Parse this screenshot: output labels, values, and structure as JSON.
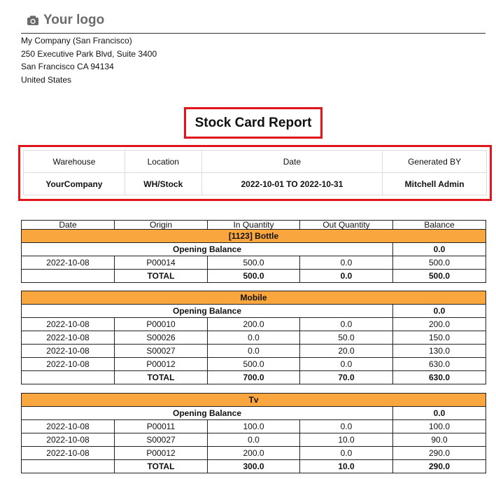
{
  "logo": {
    "text": "Your logo",
    "icon": "camera-icon"
  },
  "company": {
    "lines": [
      "My Company (San Francisco)",
      "250 Executive Park Blvd, Suite 3400",
      "San Francisco CA 94134",
      "United States"
    ]
  },
  "report": {
    "title": "Stock Card Report"
  },
  "info": {
    "headers": [
      "Warehouse",
      "Location",
      "Date",
      "Generated BY"
    ],
    "values": [
      "YourCompany",
      "WH/Stock",
      "2022-10-01 TO 2022-10-31",
      "Mitchell Admin"
    ]
  },
  "columns": [
    "Date",
    "Origin",
    "In Quantity",
    "Out Quantity",
    "Balance"
  ],
  "opening_label": "Opening Balance",
  "total_label": "TOTAL",
  "products": [
    {
      "name": "[1123] Bottle",
      "opening": "0.0",
      "rows": [
        {
          "date": "2022-10-08",
          "origin": "P00014",
          "in": "500.0",
          "out": "0.0",
          "balance": "500.0"
        }
      ],
      "total": {
        "in": "500.0",
        "out": "0.0",
        "balance": "500.0"
      }
    },
    {
      "name": "Mobile",
      "opening": "0.0",
      "rows": [
        {
          "date": "2022-10-08",
          "origin": "P00010",
          "in": "200.0",
          "out": "0.0",
          "balance": "200.0"
        },
        {
          "date": "2022-10-08",
          "origin": "S00026",
          "in": "0.0",
          "out": "50.0",
          "balance": "150.0"
        },
        {
          "date": "2022-10-08",
          "origin": "S00027",
          "in": "0.0",
          "out": "20.0",
          "balance": "130.0"
        },
        {
          "date": "2022-10-08",
          "origin": "P00012",
          "in": "500.0",
          "out": "0.0",
          "balance": "630.0"
        }
      ],
      "total": {
        "in": "700.0",
        "out": "70.0",
        "balance": "630.0"
      }
    },
    {
      "name": "Tv",
      "opening": "0.0",
      "rows": [
        {
          "date": "2022-10-08",
          "origin": "P00011",
          "in": "100.0",
          "out": "0.0",
          "balance": "100.0"
        },
        {
          "date": "2022-10-08",
          "origin": "S00027",
          "in": "0.0",
          "out": "10.0",
          "balance": "90.0"
        },
        {
          "date": "2022-10-08",
          "origin": "P00012",
          "in": "200.0",
          "out": "0.0",
          "balance": "290.0"
        }
      ],
      "total": {
        "in": "300.0",
        "out": "10.0",
        "balance": "290.0"
      }
    }
  ],
  "colors": {
    "highlight_border": "#e0141b",
    "product_row": "#f9a63f"
  }
}
